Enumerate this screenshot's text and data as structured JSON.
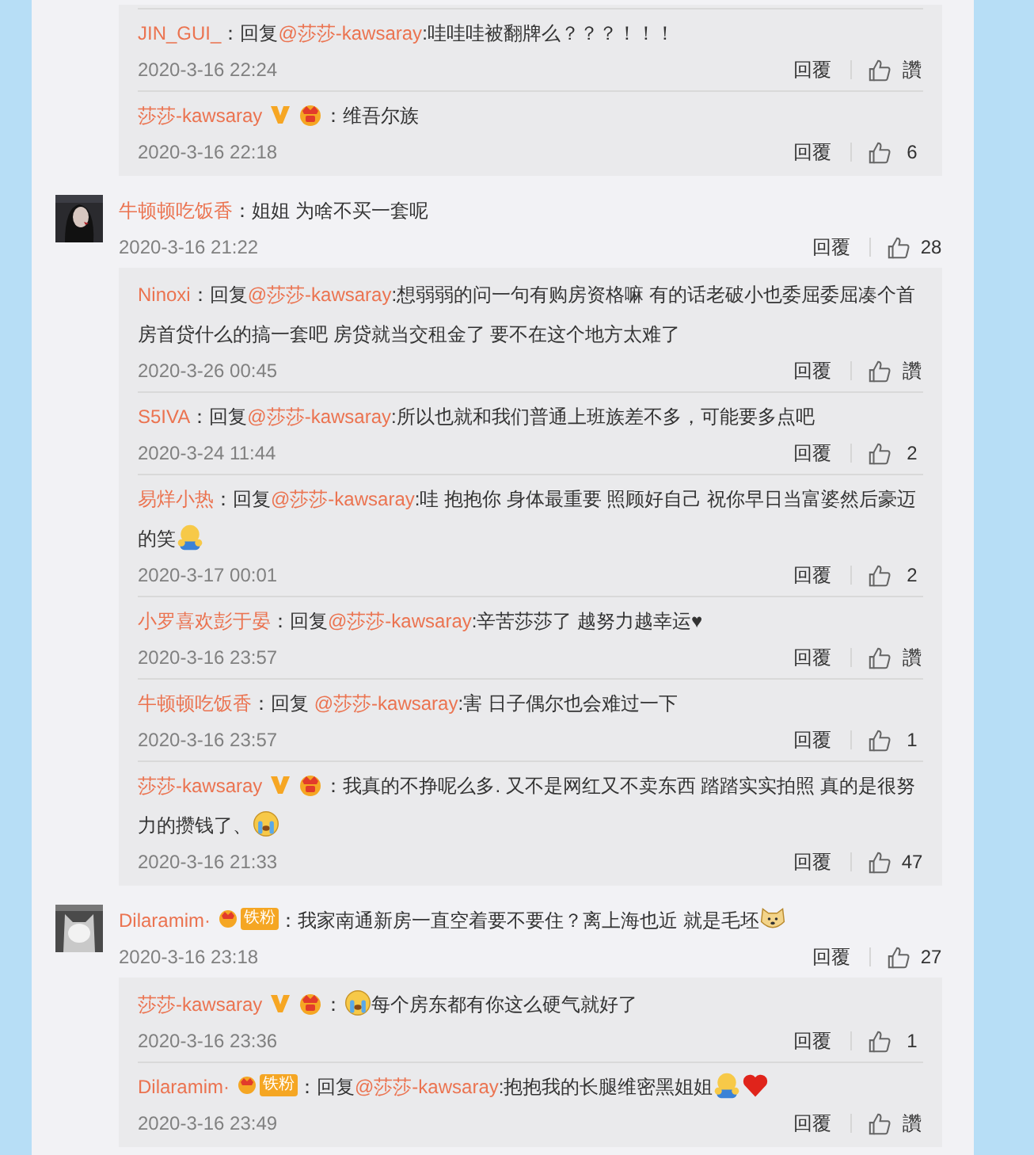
{
  "threads": [
    {
      "kind": "replies_only",
      "replies": [
        {
          "name": "JIN_GUI_",
          "parts": [
            {
              "kind": "text",
              "text": "：回复"
            },
            {
              "kind": "mention",
              "text": "@莎莎-kawsaray"
            },
            {
              "kind": "text",
              "text": ":哇哇哇被翻牌么？？？！！！"
            }
          ],
          "date": "2020-3-16 22:24",
          "reply": "回覆",
          "likes": "讚"
        },
        {
          "name": "莎莎-kawsaray",
          "badges": [
            {
              "kind": "verified"
            },
            {
              "kind": "crown"
            }
          ],
          "parts": [
            {
              "kind": "text",
              "text": "：维吾尔族"
            }
          ],
          "date": "2020-3-16 22:18",
          "reply": "回覆",
          "likes": "6"
        }
      ]
    },
    {
      "kind": "comment",
      "name": "牛顿顿吃饭香",
      "parts": [
        {
          "kind": "text",
          "text": "：姐姐 为啥不买一套呢"
        }
      ],
      "date": "2020-3-16 21:22",
      "reply": "回覆",
      "likes": "28",
      "replies": [
        {
          "name": "Ninoxi",
          "parts": [
            {
              "kind": "text",
              "text": "：回复"
            },
            {
              "kind": "mention",
              "text": "@莎莎-kawsaray"
            },
            {
              "kind": "text",
              "text": ":想弱弱的问一句有购房资格嘛 有的话老破小也委屈委屈凑个首房首贷什么的搞一套吧 房贷就当交租金了 要不在这个地方太难了"
            }
          ],
          "date": "2020-3-26 00:45",
          "reply": "回覆",
          "likes": "讚"
        },
        {
          "name": "S5IVA",
          "parts": [
            {
              "kind": "text",
              "text": "：回复"
            },
            {
              "kind": "mention",
              "text": "@莎莎-kawsaray"
            },
            {
              "kind": "text",
              "text": ":所以也就和我们普通上班族差不多，可能要多点吧"
            }
          ],
          "date": "2020-3-24 11:44",
          "reply": "回覆",
          "likes": "2"
        },
        {
          "name": "易烊小热",
          "parts": [
            {
              "kind": "text",
              "text": "：回复"
            },
            {
              "kind": "mention",
              "text": "@莎莎-kawsaray"
            },
            {
              "kind": "text",
              "text": ":哇 抱抱你 身体最重要 照顾好自己 祝你早日当富婆然后豪迈的笑"
            },
            {
              "kind": "hug"
            }
          ],
          "date": "2020-3-17 00:01",
          "reply": "回覆",
          "likes": "2"
        },
        {
          "name": "小罗喜欢彭于晏",
          "parts": [
            {
              "kind": "text",
              "text": "：回复"
            },
            {
              "kind": "mention",
              "text": "@莎莎-kawsaray"
            },
            {
              "kind": "text",
              "text": ":辛苦莎莎了 越努力越幸运♥"
            }
          ],
          "date": "2020-3-16 23:57",
          "reply": "回覆",
          "likes": "讚"
        },
        {
          "name": "牛顿顿吃饭香",
          "parts": [
            {
              "kind": "text",
              "text": "：回复 "
            },
            {
              "kind": "mention",
              "text": "@莎莎-kawsaray"
            },
            {
              "kind": "text",
              "text": ":害 日子偶尔也会难过一下"
            }
          ],
          "date": "2020-3-16 23:57",
          "reply": "回覆",
          "likes": "1"
        },
        {
          "name": "莎莎-kawsaray",
          "badges": [
            {
              "kind": "verified"
            },
            {
              "kind": "crown"
            }
          ],
          "parts": [
            {
              "kind": "text",
              "text": "：我真的不挣呢么多. 又不是网红又不卖东西 踏踏实实拍照 真的是很努力的攒钱了、"
            },
            {
              "kind": "cry"
            }
          ],
          "date": "2020-3-16 21:33",
          "reply": "回覆",
          "likes": "47"
        }
      ]
    },
    {
      "kind": "comment",
      "name": "Dilaramim·",
      "badges": [
        {
          "kind": "fan",
          "label": "铁粉"
        }
      ],
      "parts": [
        {
          "kind": "text",
          "text": "：我家南通新房一直空着要不要住？离上海也近 就是毛坯"
        },
        {
          "kind": "dog"
        }
      ],
      "date": "2020-3-16 23:18",
      "reply": "回覆",
      "likes": "27",
      "replies": [
        {
          "name": "莎莎-kawsaray",
          "badges": [
            {
              "kind": "verified"
            },
            {
              "kind": "crown"
            }
          ],
          "parts": [
            {
              "kind": "text",
              "text": "："
            },
            {
              "kind": "cry"
            },
            {
              "kind": "text",
              "text": "每个房东都有你这么硬气就好了"
            }
          ],
          "date": "2020-3-16 23:36",
          "reply": "回覆",
          "likes": "1"
        },
        {
          "name": "Dilaramim·",
          "badges": [
            {
              "kind": "fan",
              "label": "铁粉"
            }
          ],
          "parts": [
            {
              "kind": "text",
              "text": "：回复"
            },
            {
              "kind": "mention",
              "text": "@莎莎-kawsaray"
            },
            {
              "kind": "text",
              "text": ":抱抱我的长腿维密黑姐姐"
            },
            {
              "kind": "hug"
            },
            {
              "kind": "heart"
            }
          ],
          "date": "2020-3-16 23:49",
          "reply": "回覆",
          "likes": "讚"
        }
      ]
    }
  ]
}
